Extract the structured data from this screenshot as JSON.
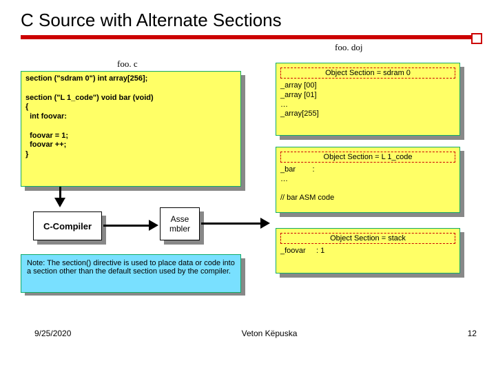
{
  "title": "C Source with Alternate Sections",
  "labels": {
    "doj": "foo. doj",
    "src": "foo. c"
  },
  "code": {
    "line1": "section (\"sdram 0\") int array[256];",
    "line2": "section (\"L 1_code\") void bar (void)",
    "line3": "{",
    "line4": "  int foovar:",
    "line5": "  foovar = 1;",
    "line6": "  foovar ++;",
    "line7": "}"
  },
  "obj1": {
    "title": "Object Section = sdram 0",
    "l1": "_array [00]",
    "l2": "_array [01]",
    "l3": "…",
    "l4": "_array[255]"
  },
  "obj2": {
    "title": "Object Section = L 1_code",
    "l1": "_bar        :",
    "l2": "…",
    "l3": "// bar ASM code"
  },
  "obj3": {
    "title": "Object Section = stack",
    "l1": "_foovar     : 1"
  },
  "compiler": "C-Compiler",
  "assembler": "Asse\nmbler",
  "note": "Note: The section() directive is used to place data or code into a section other than the default section used by the compiler.",
  "footer": {
    "date": "9/25/2020",
    "author": "Veton Këpuska",
    "page": "12"
  }
}
